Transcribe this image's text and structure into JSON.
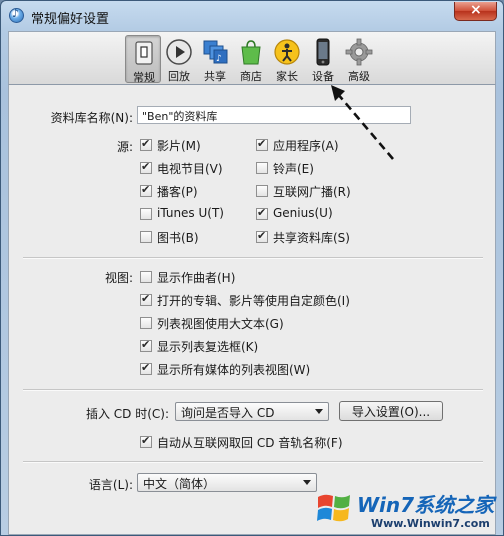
{
  "window": {
    "title": "常规偏好设置",
    "close_symbol": "×"
  },
  "toolbar": {
    "items": [
      {
        "label": "常规",
        "icon": "general-icon",
        "selected": true
      },
      {
        "label": "回放",
        "icon": "playback-icon"
      },
      {
        "label": "共享",
        "icon": "sharing-icon"
      },
      {
        "label": "商店",
        "icon": "store-icon"
      },
      {
        "label": "家长",
        "icon": "parental-icon"
      },
      {
        "label": "设备",
        "icon": "device-icon"
      },
      {
        "label": "高级",
        "icon": "advanced-gear-icon"
      }
    ]
  },
  "library": {
    "label": "资料库名称(N):",
    "value": "\"Ben\"的资料库"
  },
  "sources": {
    "label": "源:",
    "items": [
      {
        "label": "影片(M)",
        "checked": true
      },
      {
        "label": "应用程序(A)",
        "checked": true
      },
      {
        "label": "电视节目(V)",
        "checked": true
      },
      {
        "label": "铃声(E)",
        "checked": false
      },
      {
        "label": "播客(P)",
        "checked": true
      },
      {
        "label": "互联网广播(R)",
        "checked": false
      },
      {
        "label": "iTunes U(T)",
        "checked": false
      },
      {
        "label": "Genius(U)",
        "checked": true
      },
      {
        "label": "图书(B)",
        "checked": false
      },
      {
        "label": "共享资料库(S)",
        "checked": true
      }
    ]
  },
  "views": {
    "label": "视图:",
    "items": [
      {
        "label": "显示作曲者(H)",
        "checked": false
      },
      {
        "label": "打开的专辑、影片等使用自定颜色(I)",
        "checked": true
      },
      {
        "label": "列表视图使用大文本(G)",
        "checked": false
      },
      {
        "label": "显示列表复选框(K)",
        "checked": true
      },
      {
        "label": "显示所有媒体的列表视图(W)",
        "checked": true
      }
    ]
  },
  "cd": {
    "label": "插入 CD 时(C):",
    "value": "询问是否导入 CD",
    "import_button": "导入设置(O)...",
    "auto_fetch": {
      "label": "自动从互联网取回 CD 音轨名称(F)",
      "checked": true
    }
  },
  "language": {
    "label": "语言(L):",
    "value": "中文（简体）"
  },
  "watermark": {
    "brand": "Win7系统之家",
    "url": "Www.Winwin7.com"
  },
  "colors": {
    "accent": "#1565b8",
    "titlebar": "#b3cbe4",
    "close": "#cf4f37"
  }
}
